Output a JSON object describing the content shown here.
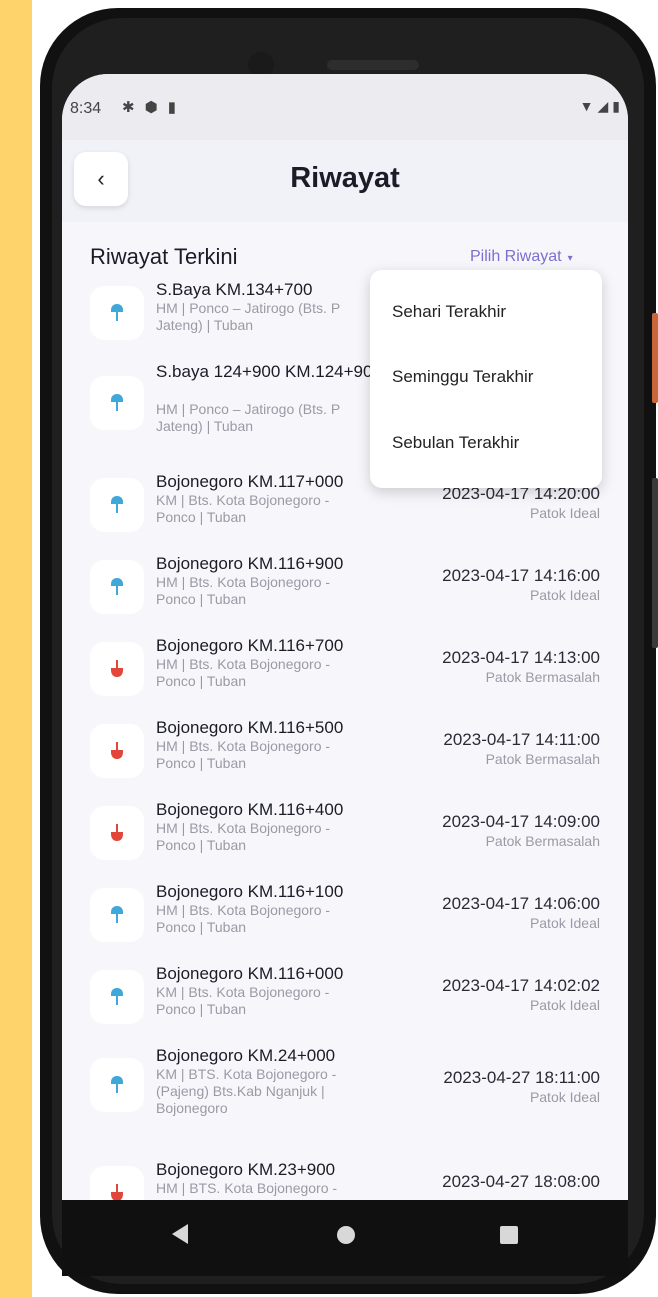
{
  "status_bar": {
    "time": "8:34"
  },
  "header": {
    "back_label": "‹",
    "title": "Riwayat"
  },
  "section": {
    "title": "Riwayat Terkini",
    "filter_label": "Pilih Riwayat",
    "filter_arrow": "▾"
  },
  "dropdown": {
    "items": [
      "Sehari Terakhir",
      "Seminggu Terakhir",
      "Sebulan Terakhir"
    ]
  },
  "colors": {
    "ideal": "#40a8d8",
    "problem": "#e2453a",
    "accent": "#7b6fd0"
  },
  "items": [
    {
      "name": "S.Baya KM.134+700",
      "sub": "HM | Ponco – Jatirogo (Bts. P Jateng) | Tuban",
      "date": "",
      "status": "",
      "kind": "ideal"
    },
    {
      "name": "S.baya 124+900 KM.124+900",
      "sub": "HM | Ponco – Jatirogo (Bts. P Jateng) | Tuban",
      "date": "",
      "status": "",
      "kind": "ideal"
    },
    {
      "name": "Bojonegoro KM.117+000",
      "sub": "KM | Bts. Kota Bojonegoro - Ponco | Tuban",
      "date": "2023-04-17 14:20:00",
      "status": "Patok Ideal",
      "kind": "ideal"
    },
    {
      "name": "Bojonegoro KM.116+900",
      "sub": "HM | Bts. Kota Bojonegoro - Ponco | Tuban",
      "date": "2023-04-17 14:16:00",
      "status": "Patok Ideal",
      "kind": "ideal"
    },
    {
      "name": "Bojonegoro KM.116+700",
      "sub": "HM | Bts. Kota Bojonegoro - Ponco | Tuban",
      "date": "2023-04-17 14:13:00",
      "status": "Patok Bermasalah",
      "kind": "problem"
    },
    {
      "name": "Bojonegoro KM.116+500",
      "sub": "HM | Bts. Kota Bojonegoro - Ponco | Tuban",
      "date": "2023-04-17 14:11:00",
      "status": "Patok Bermasalah",
      "kind": "problem"
    },
    {
      "name": "Bojonegoro KM.116+400",
      "sub": "HM | Bts. Kota Bojonegoro - Ponco | Tuban",
      "date": "2023-04-17 14:09:00",
      "status": "Patok Bermasalah",
      "kind": "problem"
    },
    {
      "name": "Bojonegoro KM.116+100",
      "sub": "HM | Bts. Kota Bojonegoro - Ponco | Tuban",
      "date": "2023-04-17 14:06:00",
      "status": "Patok Ideal",
      "kind": "ideal"
    },
    {
      "name": "Bojonegoro KM.116+000",
      "sub": "KM | Bts. Kota Bojonegoro - Ponco | Tuban",
      "date": "2023-04-17 14:02:02",
      "status": "Patok Ideal",
      "kind": "ideal"
    },
    {
      "name": "Bojonegoro KM.24+000",
      "sub": "KM | BTS. Kota Bojonegoro - (Pajeng) Bts.Kab Nganjuk | Bojonegoro",
      "date": "2023-04-27 18:11:00",
      "status": "Patok Ideal",
      "kind": "ideal"
    },
    {
      "name": "Bojonegoro KM.23+900",
      "sub": "HM | BTS. Kota Bojonegoro -",
      "date": "2023-04-27 18:08:00",
      "status": "",
      "kind": "problem"
    }
  ]
}
